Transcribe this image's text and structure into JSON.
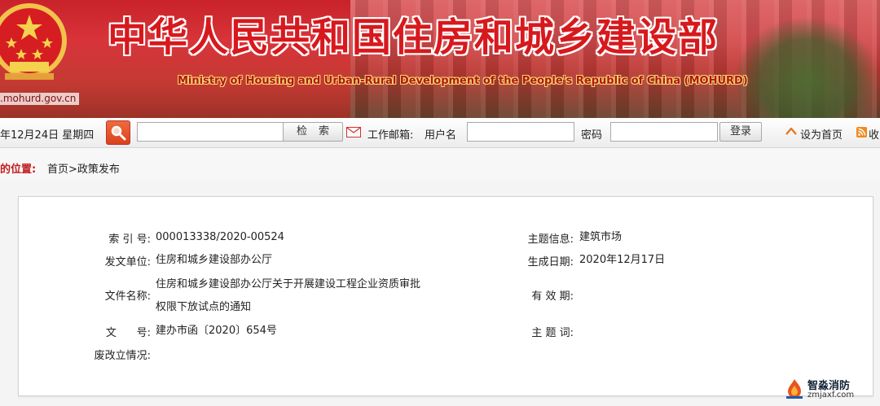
{
  "header": {
    "title_cn": "中华人民共和国住房和城乡建设部",
    "title_en": "Ministry of Housing and Urban-Rural Development of the People's Republic of China (MOHURD)",
    "site_url": ".mohurd.gov.cn",
    "colors": {
      "banner_red": "#c9222a",
      "title_red": "#d7191d"
    }
  },
  "toolbar": {
    "date": "年12月24日 星期四",
    "search_value": "",
    "search_button": "检索",
    "mail_label": "工作邮箱:",
    "user_label": "用户名",
    "user_value": "",
    "password_label": "密码",
    "password_value": "",
    "login_button": "登录",
    "home_link": "设为首页",
    "fav_link": "收"
  },
  "breadcrumb": {
    "label": "的位置:",
    "path": "首页>政策发布"
  },
  "doc_info": {
    "index_label": "索 引 号:",
    "index_value": "000013338/2020-00524",
    "issuer_label": "发文单位:",
    "issuer_value": "住房和城乡建设部办公厅",
    "name_label": "文件名称:",
    "name_line1": "住房和城乡建设部办公厅关于开展建设工程企业资质审批",
    "name_line2": "权限下放试点的通知",
    "docno_label": "文      号:",
    "docno_value": "建办市函〔2020〕654号",
    "status_label": "废改立情况:",
    "status_value": "",
    "topic_label": "主题信息:",
    "topic_value": "建筑市场",
    "date_label": "生成日期:",
    "date_value": "2020年12月17日",
    "validity_label": "有 效 期:",
    "validity_value": "",
    "keywords_label": "主 题 词:",
    "keywords_value": ""
  },
  "watermark": {
    "name": "智淼消防",
    "url": "zmjaxf.com"
  }
}
